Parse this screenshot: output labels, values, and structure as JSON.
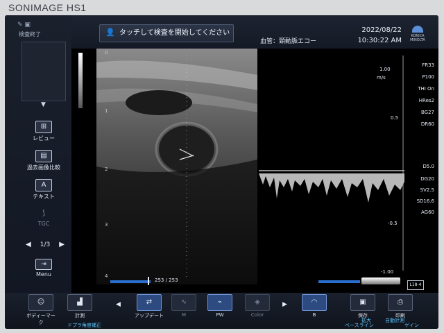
{
  "brand": "SONIMAGE HS1",
  "status": {
    "label": "検査終了"
  },
  "left_panel": {
    "review": "レビュー",
    "compare": "過去画像比較",
    "text": "テキスト",
    "tgc": "TGC",
    "page": "1/3",
    "menu": "Menu"
  },
  "topbar": {
    "touch_prompt": "タッチして検査を開始してください",
    "study": "血管：頸動脈エコー",
    "date": "2022/08/22",
    "time": "10:30:22 AM",
    "logo_text": "KONICA MINOLTA"
  },
  "image": {
    "depth_labels": [
      "0",
      "1",
      "2",
      "3",
      "4"
    ],
    "cine_counter": "253 / 253",
    "doppler_scale": {
      "top": "1.00",
      "unit": "m/s",
      "mid": "0.5",
      "low": "-0.5",
      "bottom": "-1.00"
    },
    "params_top": [
      "FR33",
      "P100",
      "THI On",
      "HRes2",
      "BG27",
      "DR60"
    ],
    "params_doppler": [
      "D5.0",
      "DG20",
      "SV2.5",
      "SD16.6",
      "AG60"
    ],
    "probe": "L18-4"
  },
  "bottom": {
    "body_mark": "ボディーマーク",
    "measure": "計測",
    "doppler_corr": "ドプラ角度補正",
    "update": "アップデート",
    "m": "M",
    "pw": "PW",
    "color": "Color",
    "b": "B",
    "baseline": "ベースライン",
    "save": "保存",
    "zoom": "拡大",
    "print": "印刷",
    "auto_measure": "自動計測",
    "gain": "ゲイン"
  }
}
